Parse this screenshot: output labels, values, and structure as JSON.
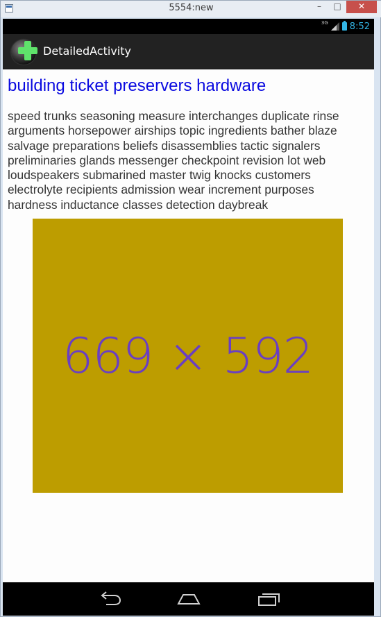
{
  "window": {
    "title": "5554:new",
    "minimize_label": "–",
    "maximize_label": "□",
    "close_label": "✕"
  },
  "statusbar": {
    "network_type": "3G",
    "time": "8:52"
  },
  "actionbar": {
    "title": "DetailedActivity"
  },
  "detail": {
    "headline": "building ticket preservers hardware",
    "body": "speed trunks seasoning measure interchanges duplicate rinse arguments horsepower airships topic ingredients bather blaze salvage preparations beliefs disassemblies tactic signalers preliminaries glands messenger checkpoint revision lot web loudspeakers submarined master twig knocks customers electrolyte recipients admission wear increment purposes hardness inductance classes detection daybreak",
    "image_label": "669 × 592",
    "image_color": "#bd9d00",
    "image_text_color": "#6a3fc2",
    "headline_color": "#0a0ae0"
  },
  "navbar": {
    "icons": [
      "back-icon",
      "home-icon",
      "recent-apps-icon"
    ]
  }
}
